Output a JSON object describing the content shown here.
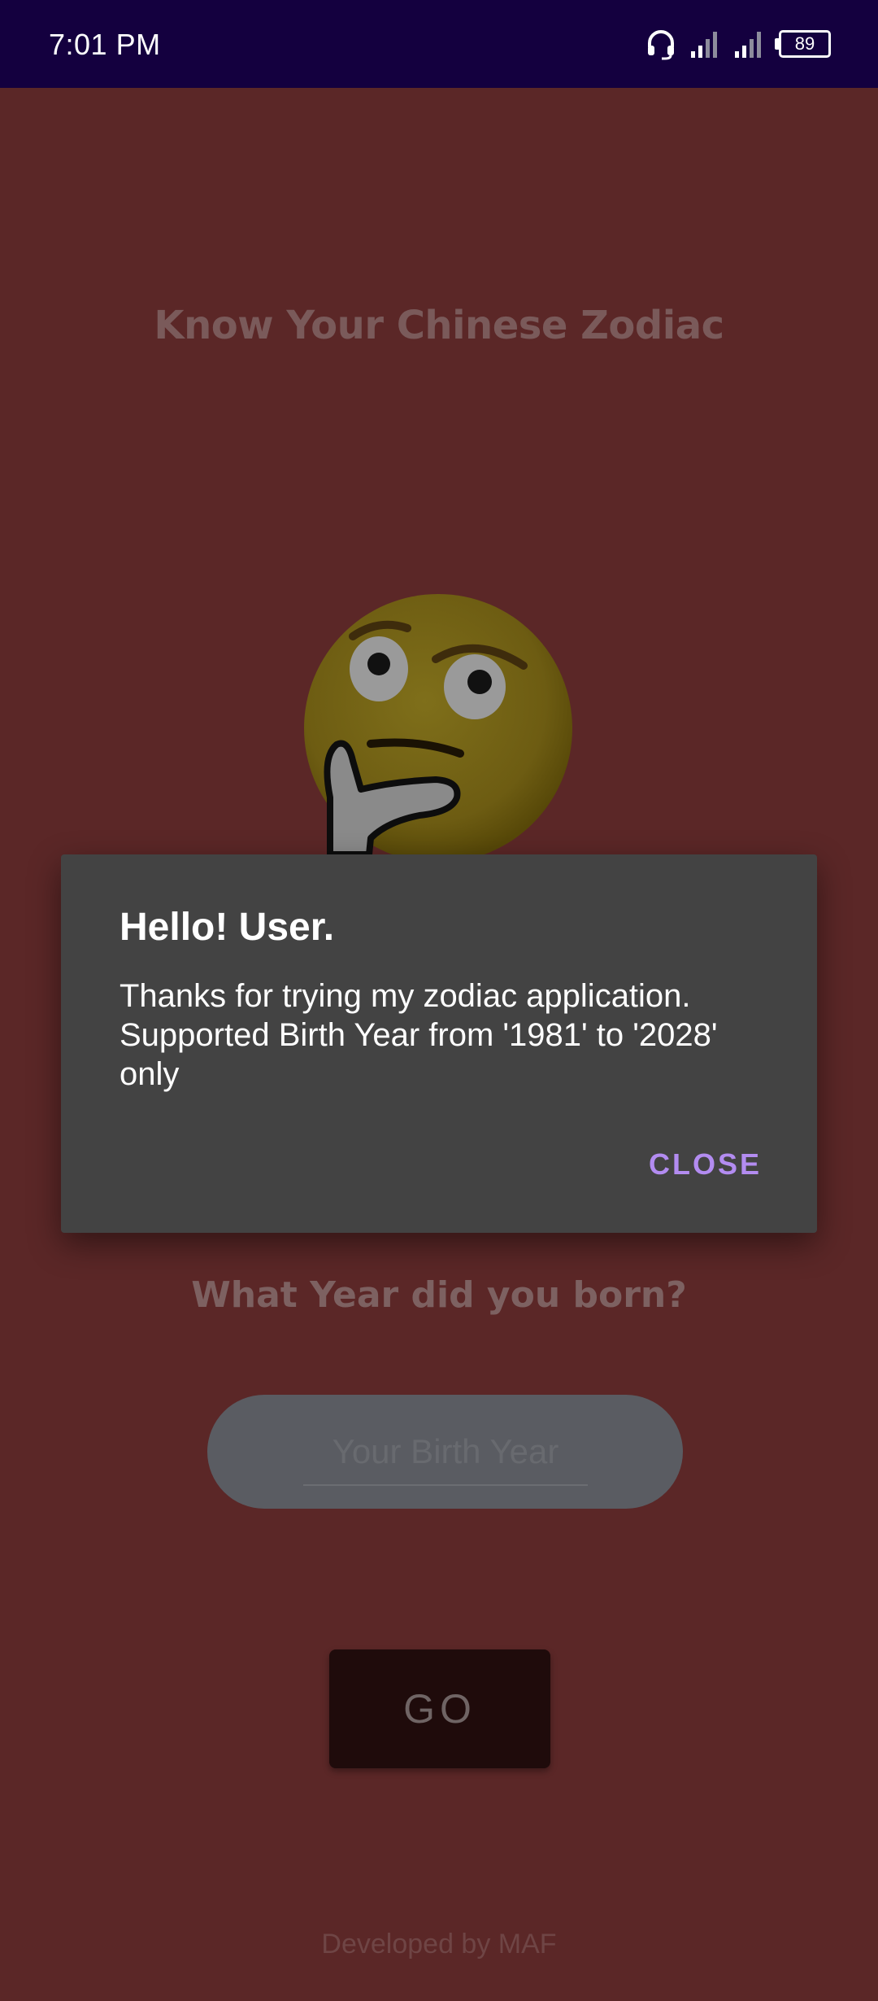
{
  "status_bar": {
    "time": "7:01 PM",
    "battery": "89",
    "icons": [
      "headset-icon",
      "signal-icon",
      "signal-icon",
      "battery-icon"
    ]
  },
  "main": {
    "title": "Know Your Chinese Zodiac",
    "emoji": "thinking-face",
    "question": "What Year did you born?",
    "input_placeholder": "Your Birth Year",
    "go_label": "GO",
    "footer": "Developed by MAF"
  },
  "dialog": {
    "title": "Hello! User.",
    "message": "Thanks for trying my zodiac application. Supported Birth Year from '1981' to '2028' only",
    "close_label": "CLOSE"
  },
  "colors": {
    "status_bar": "#14003f",
    "background": "#5b2727",
    "dialog_bg": "#434343",
    "accent": "#b38cf1"
  }
}
